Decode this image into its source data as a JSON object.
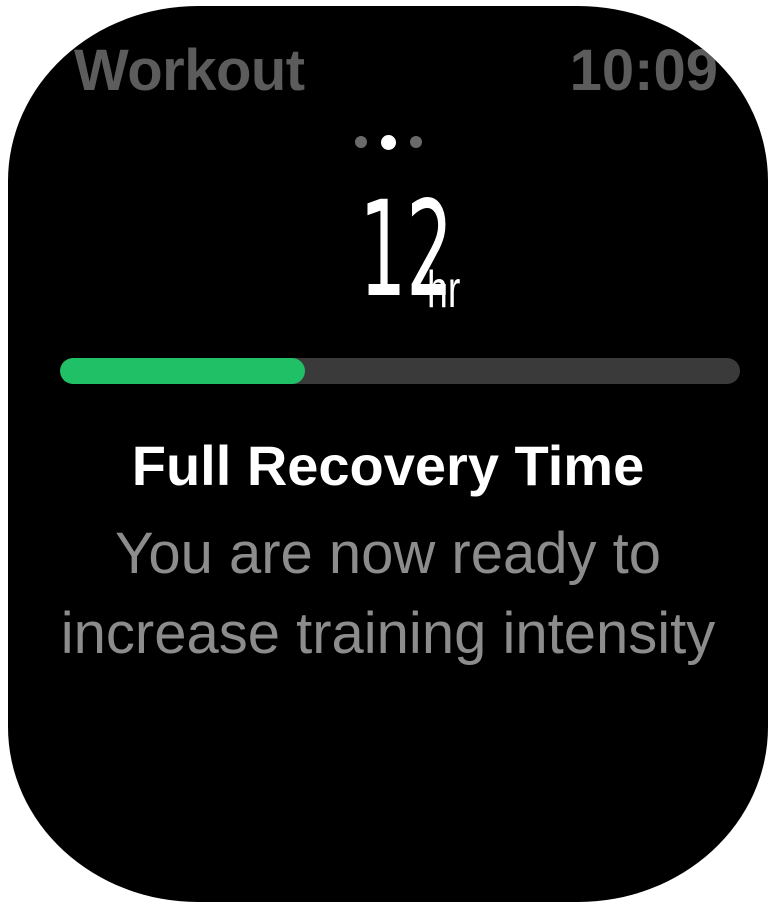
{
  "status_bar": {
    "app_title": "Workout",
    "time": "10:09"
  },
  "pager": {
    "count": 3,
    "active_index": 1
  },
  "metric": {
    "value": "12",
    "unit": "hr"
  },
  "progress": {
    "fraction": 0.36,
    "fill_color": "#1fc066",
    "track_color": "#3a3a3a"
  },
  "card": {
    "title": "Full Recovery Time",
    "body": "You are now ready to increase training intensity"
  }
}
